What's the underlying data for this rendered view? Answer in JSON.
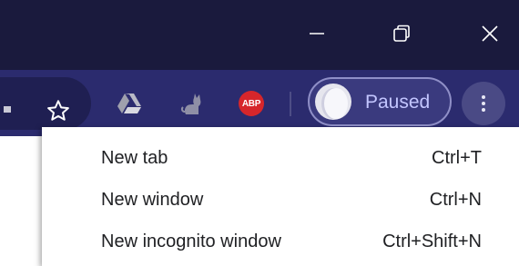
{
  "window_controls": {
    "minimize_icon": "minimize-icon",
    "restore_icon": "restore-icon",
    "close_icon": "close-icon"
  },
  "toolbar": {
    "bookmark_icon": "star-icon",
    "extensions": [
      {
        "name": "Google Drive",
        "icon": "drive-icon"
      },
      {
        "name": "cat extension",
        "icon": "cat-icon"
      },
      {
        "name": "Adblock Plus",
        "icon": "abp-icon",
        "badge": "ABP"
      }
    ],
    "profile": {
      "status": "Paused",
      "avatar_icon": "avatar"
    },
    "menu_icon": "kebab-menu-icon"
  },
  "menu": {
    "items": [
      {
        "label": "New tab",
        "shortcut": "Ctrl+T"
      },
      {
        "label": "New window",
        "shortcut": "Ctrl+N"
      },
      {
        "label": "New incognito window",
        "shortcut": "Ctrl+Shift+N"
      }
    ]
  },
  "colors": {
    "titlebar": "#1a1a3d",
    "toolbar": "#2b2b6e",
    "profile_text": "#c3c6ff",
    "abp_red": "#d6262b",
    "menu_text": "#202124"
  }
}
